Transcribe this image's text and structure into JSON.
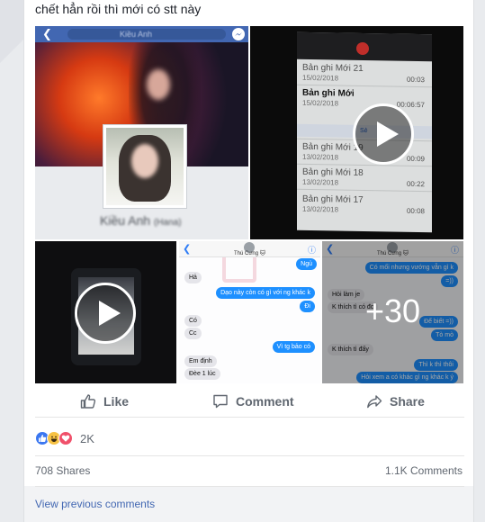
{
  "post": {
    "text": "chết hẳn rồi thì mới có stt này"
  },
  "tiles": {
    "profile": {
      "search": "Kiều Anh",
      "name": "Kiều Anh",
      "name_suffix": "(Hana)"
    },
    "recordings": {
      "items": [
        {
          "title": "Bản ghi Mới 21",
          "date": "15/02/2018",
          "duration": "00:03"
        },
        {
          "title": "Bản ghi Mới",
          "date": "15/02/2018",
          "duration": "00:06:57"
        },
        {
          "title": "Bản ghi Mới 19",
          "date": "13/02/2018",
          "duration": "00:09"
        },
        {
          "title": "Bản ghi Mới 18",
          "date": "13/02/2018",
          "duration": "00:22"
        },
        {
          "title": "Bản ghi Mới 17",
          "date": "13/02/2018",
          "duration": "00:08"
        }
      ],
      "share_label": "Sẻ"
    },
    "chat1": {
      "contact": "Thú Cưng 🐱",
      "messages": [
        {
          "dir": "out",
          "text": "Ngủ"
        },
        {
          "dir": "in",
          "text": "Hả"
        },
        {
          "dir": "out",
          "text": "Dạo này còn có gì với ng khác k"
        },
        {
          "dir": "out",
          "text": "Đi"
        },
        {
          "dir": "in",
          "text": "Có"
        },
        {
          "dir": "in",
          "text": "Cc"
        },
        {
          "dir": "out",
          "text": "Vì tg bảo có"
        },
        {
          "dir": "in",
          "text": "Em định"
        },
        {
          "dir": "in",
          "text": "Đèe 1 lúc"
        }
      ]
    },
    "chat2": {
      "contact": "Thú Cưng 🐱",
      "more_count": "+30",
      "messages": [
        {
          "dir": "out",
          "text": "Có mối nhưng vướng vẫn gì k"
        },
        {
          "dir": "out",
          "text": "=))"
        },
        {
          "dir": "in",
          "text": "Hỏi làm je"
        },
        {
          "dir": "in",
          "text": "K thích tì có đc"
        },
        {
          "dir": "out",
          "text": "Để biết =))"
        },
        {
          "dir": "out",
          "text": "Tò mò"
        },
        {
          "dir": "in",
          "text": "K thích tì đấy"
        },
        {
          "dir": "out",
          "text": "Thì k thì thôi"
        },
        {
          "dir": "out",
          "text": "Hỏi xem a có khác gì ng khác k ý"
        }
      ]
    }
  },
  "actions": {
    "like": "Like",
    "comment": "Comment",
    "share": "Share"
  },
  "reactions": {
    "count": "2K",
    "types": [
      "like-icon",
      "haha-icon",
      "love-icon"
    ]
  },
  "stats": {
    "shares": "708 Shares",
    "comments": "1.1K Comments"
  },
  "comments": {
    "view_previous": "View previous comments"
  },
  "colors": {
    "facebook_blue": "#4267b2",
    "like_blue": "#3b77f0",
    "love_red": "#f0506a",
    "haha_yellow": "#f7c244"
  }
}
